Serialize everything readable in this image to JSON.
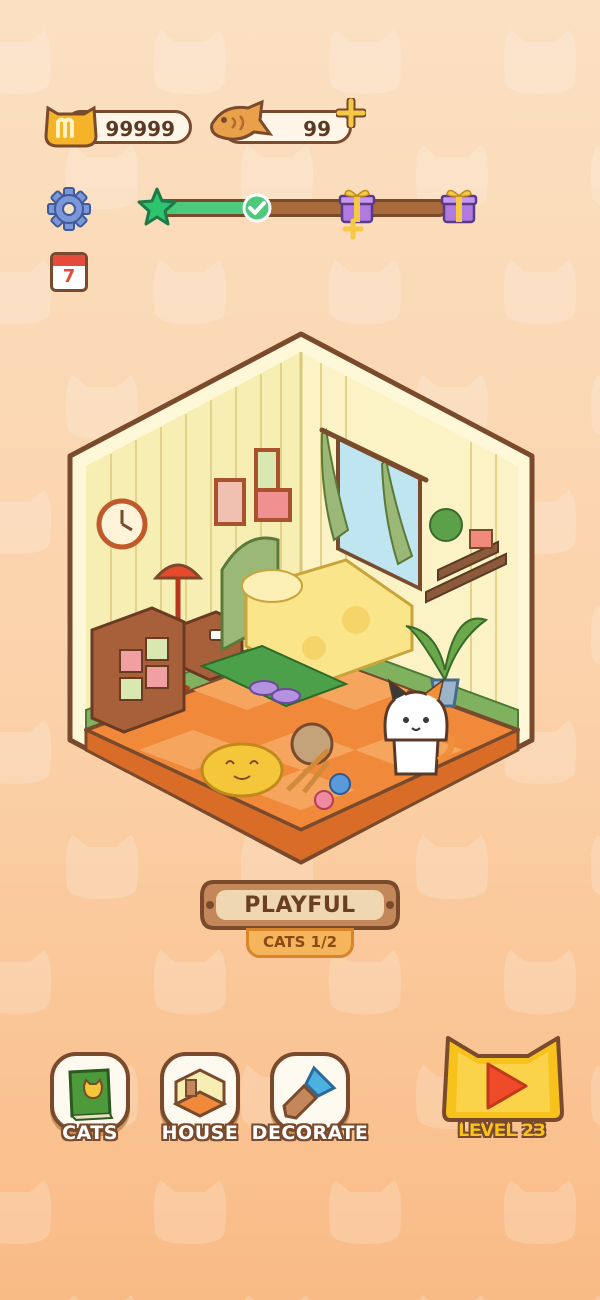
{
  "currency": {
    "coins_value": "99999",
    "fish_value": "99",
    "coin_icon": "cat-coin-icon",
    "fish_icon": "taiyaki-fish-icon",
    "add_icon": "plus-icon"
  },
  "progress": {
    "fraction": 0.38,
    "start_icon": "star-icon",
    "checkpoint_icon": "check-icon",
    "rewards": [
      "gift-icon",
      "gift-icon"
    ]
  },
  "side_buttons": {
    "settings_icon": "gear-icon",
    "calendar_day": "7"
  },
  "room": {
    "mood_label": "PLAYFUL",
    "cats_label": "CATS 1/2"
  },
  "nav": {
    "cats_label": "CATS",
    "house_label": "HOUSE",
    "decorate_label": "DECORATE",
    "level_label": "LEVEL 23"
  },
  "colors": {
    "outline": "#7a4a2c",
    "progress_green": "#4cc97a",
    "level_yellow": "#f7c21c",
    "play_red": "#ef4a2a"
  }
}
